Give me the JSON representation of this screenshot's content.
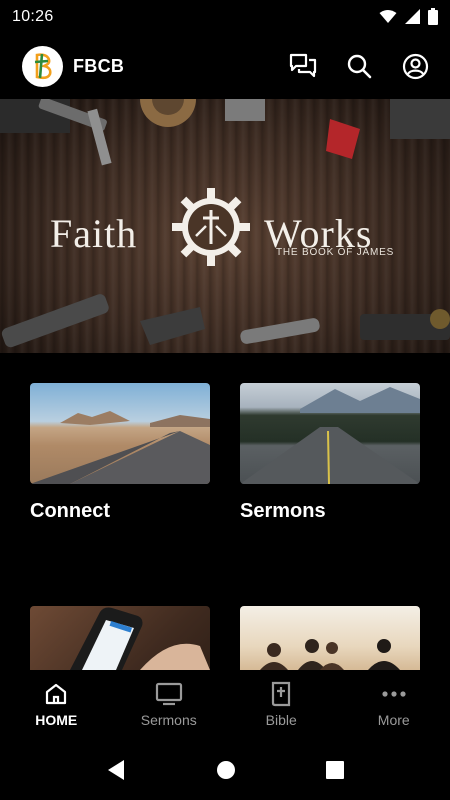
{
  "status_bar": {
    "time": "10:26"
  },
  "app_bar": {
    "title": "FBCB",
    "logo_letter": "B"
  },
  "hero": {
    "word_left": "Faith",
    "word_right": "Works",
    "subtitle": "THE BOOK OF JAMES"
  },
  "tiles": [
    {
      "title": "Connect",
      "image": "desert-road-photo"
    },
    {
      "title": "Sermons",
      "image": "forest-road-photo"
    },
    {
      "title": "",
      "image": "phone-in-hands-photo"
    },
    {
      "title": "",
      "image": "people-at-sunset-photo"
    }
  ],
  "bottom_nav": [
    {
      "label": "HOME",
      "icon": "home-icon",
      "active": true
    },
    {
      "label": "Sermons",
      "icon": "tv-icon",
      "active": false
    },
    {
      "label": "Bible",
      "icon": "bible-icon",
      "active": false
    },
    {
      "label": "More",
      "icon": "more-dots-icon",
      "active": false
    }
  ],
  "colors": {
    "background": "#000000",
    "inactive_label": "#9a9a9a",
    "logo_green": "#2e8b3a",
    "logo_orange": "#f2a01c"
  }
}
